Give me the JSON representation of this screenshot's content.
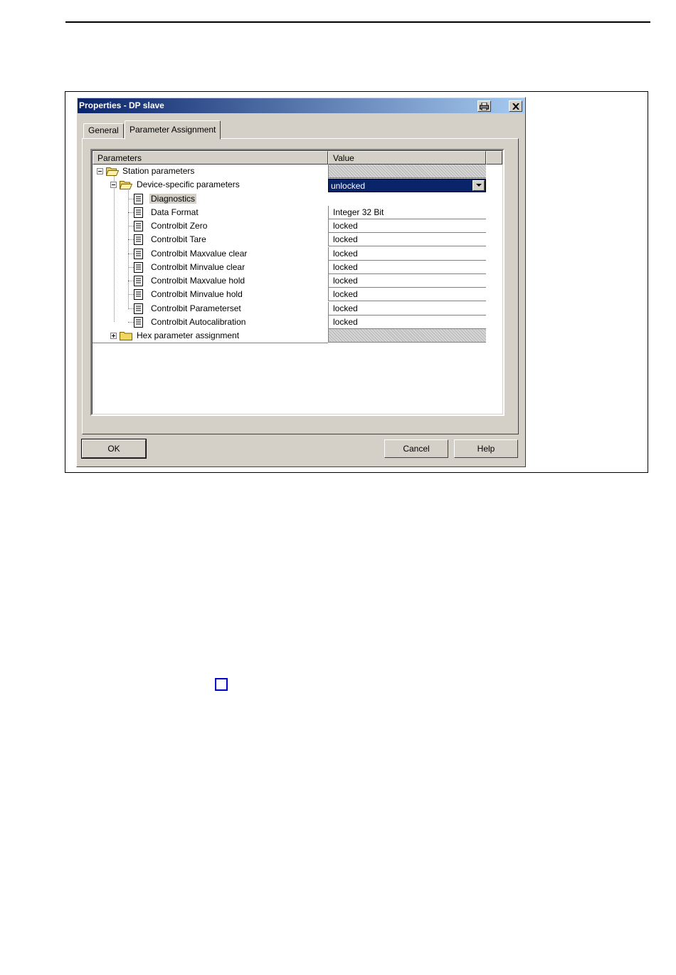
{
  "dialog": {
    "title": "Properties - DP slave",
    "tabs": [
      {
        "label": "General",
        "active": false
      },
      {
        "label": "Parameter Assignment",
        "active": true
      }
    ]
  },
  "grid": {
    "columns": [
      "Parameters",
      "Value"
    ],
    "rows": [
      {
        "label": "Station parameters",
        "value": "",
        "hatched": true
      },
      {
        "label": "Device-specific parameters",
        "value": "",
        "hatched": true
      },
      {
        "label": "Diagnostics",
        "value": "unlocked",
        "selected": true
      },
      {
        "label": "Data Format",
        "value": "Integer 32 Bit"
      },
      {
        "label": "Controlbit Zero",
        "value": "locked"
      },
      {
        "label": "Controlbit Tare",
        "value": "locked"
      },
      {
        "label": "Controlbit Maxvalue clear",
        "value": "locked"
      },
      {
        "label": "Controlbit Minvalue clear",
        "value": "locked"
      },
      {
        "label": "Controlbit Maxvalue hold",
        "value": "locked"
      },
      {
        "label": "Controlbit Minvalue hold",
        "value": "locked"
      },
      {
        "label": "Controlbit Parameterset",
        "value": "locked"
      },
      {
        "label": "Controlbit Autocalibration",
        "value": "locked"
      },
      {
        "label": "Hex parameter assignment",
        "value": "",
        "hatched": true
      }
    ]
  },
  "buttons": {
    "ok": "OK",
    "cancel": "Cancel",
    "help": "Help"
  },
  "colors": {
    "title_start": "#0a246a",
    "title_end": "#a6caf0",
    "dialog_face": "#d4d0c8",
    "selection": "#0a246a",
    "marker": "#0000cc"
  }
}
